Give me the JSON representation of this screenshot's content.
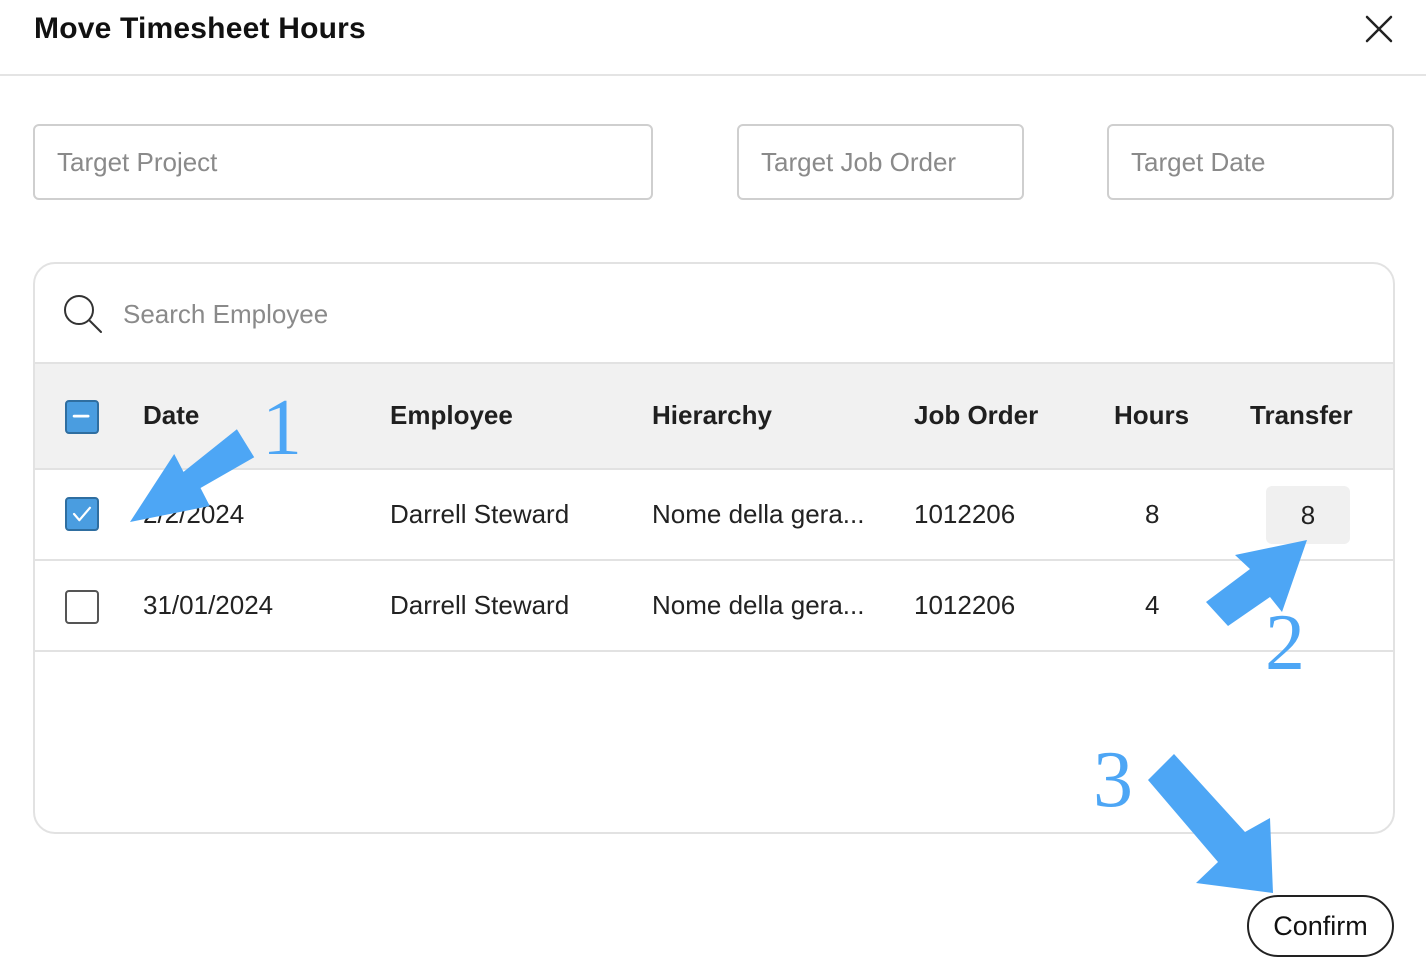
{
  "dialog": {
    "title": "Move Timesheet Hours"
  },
  "fields": {
    "target_project_placeholder": "Target Project",
    "target_job_order_placeholder": "Target Job Order",
    "target_date_placeholder": "Target Date"
  },
  "search": {
    "placeholder": "Search Employee"
  },
  "table": {
    "columns": {
      "date": "Date",
      "employee": "Employee",
      "hierarchy": "Hierarchy",
      "job_order": "Job Order",
      "hours": "Hours",
      "transfer": "Transfer"
    },
    "rows": [
      {
        "date": "2/2/2024",
        "employee": "Darrell Steward",
        "hierarchy": "Nome della gera...",
        "job_order": "1012206",
        "hours": "8",
        "transfer": "8",
        "selected": true
      },
      {
        "date": "31/01/2024",
        "employee": "Darrell Steward",
        "hierarchy": "Nome della gera...",
        "job_order": "1012206",
        "hours": "4",
        "transfer": "",
        "selected": false
      }
    ]
  },
  "actions": {
    "confirm_label": "Confirm"
  },
  "annotations": {
    "step1": "1",
    "step2": "2",
    "step3": "3"
  },
  "colors": {
    "accent": "#4a9de0",
    "annotation": "#4da6f5",
    "header_bg": "#f1f1f1"
  },
  "icons": {
    "close": "close-icon",
    "search": "search-icon",
    "checkbox_indeterminate": "minus-icon",
    "checkbox_checked": "check-icon"
  }
}
